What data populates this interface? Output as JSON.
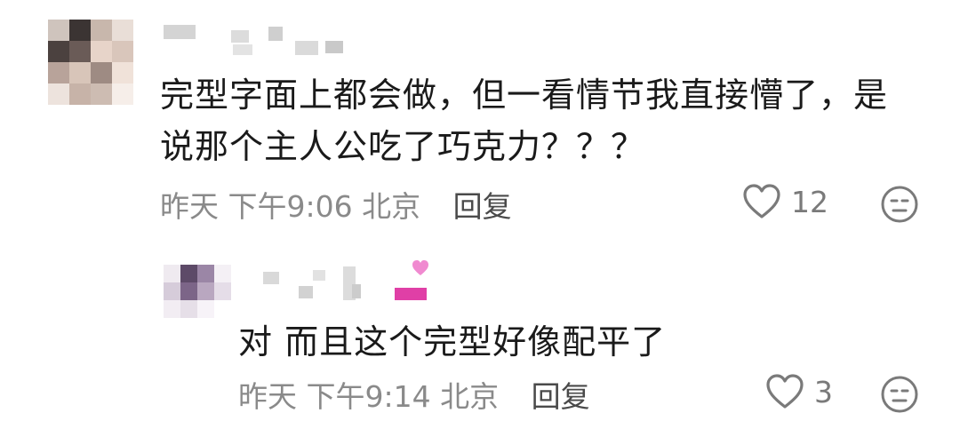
{
  "comments": [
    {
      "text_line1": "完型字面上都会做，但一看情节我直接懵了，是",
      "text_line2": "说那个主人公吃了巧克力？？？",
      "time": "昨天 下午9:06 北京",
      "reply_label": "回复",
      "likes": "12"
    },
    {
      "text": "对 而且这个完型好像配平了",
      "time": "昨天 下午9:14 北京",
      "reply_label": "回复",
      "likes": "3"
    }
  ],
  "colors": {
    "text": "#1a1a1a",
    "meta": "#8a8a8a",
    "icon": "#7a7a7a",
    "badge": "#e03fa6"
  },
  "icons": [
    "heart-outline-icon",
    "emoji-face-icon",
    "heart-badge-icon"
  ]
}
